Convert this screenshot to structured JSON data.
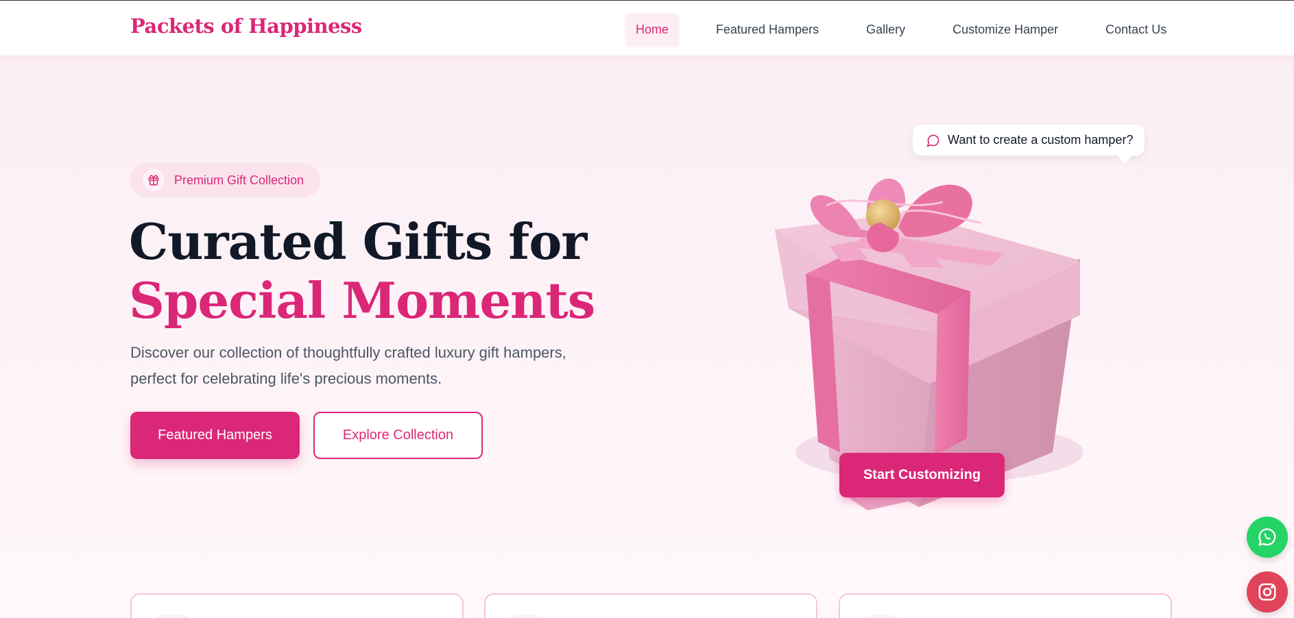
{
  "brand": {
    "name": "Packets of Happiness",
    "accent": "#db2777"
  },
  "nav": {
    "items": [
      {
        "label": "Home",
        "active": true
      },
      {
        "label": "Featured Hampers",
        "active": false
      },
      {
        "label": "Gallery",
        "active": false
      },
      {
        "label": "Customize Hamper",
        "active": false
      },
      {
        "label": "Contact Us",
        "active": false
      }
    ]
  },
  "hero": {
    "badge": {
      "icon": "gift-icon",
      "label": "Premium Gift Collection"
    },
    "title_line1": "Curated Gifts for",
    "title_line2": "Special Moments",
    "description": "Discover our collection of thoughtfully crafted luxury gift hampers, perfect for celebrating life's precious moments.",
    "primary_button": "Featured Hampers",
    "secondary_button": "Explore Collection"
  },
  "visual": {
    "image": "pink-gift-box",
    "speech_bubble": {
      "icon": "message-circle-icon",
      "text": "Want to create a custom hamper?"
    },
    "cta_button": "Start Customizing"
  },
  "floating": [
    {
      "icon": "whatsapp-icon",
      "color": "#25d366"
    },
    {
      "icon": "instagram-icon",
      "color": "#e0435a"
    }
  ],
  "cards_count": 3
}
